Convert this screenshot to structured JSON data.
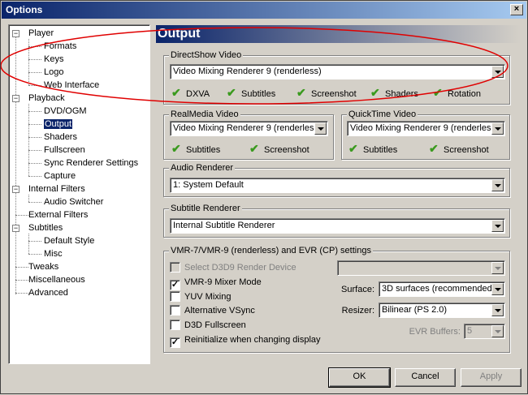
{
  "window": {
    "title": "Options",
    "close_label": "×"
  },
  "tree": {
    "items": [
      {
        "label": "Player"
      },
      {
        "label": "Formats"
      },
      {
        "label": "Keys"
      },
      {
        "label": "Logo"
      },
      {
        "label": "Web Interface"
      },
      {
        "label": "Playback"
      },
      {
        "label": "DVD/OGM"
      },
      {
        "label": "Output"
      },
      {
        "label": "Shaders"
      },
      {
        "label": "Fullscreen"
      },
      {
        "label": "Sync Renderer Settings"
      },
      {
        "label": "Capture"
      },
      {
        "label": "Internal Filters"
      },
      {
        "label": "Audio Switcher"
      },
      {
        "label": "External Filters"
      },
      {
        "label": "Subtitles"
      },
      {
        "label": "Default Style"
      },
      {
        "label": "Misc"
      },
      {
        "label": "Tweaks"
      },
      {
        "label": "Miscellaneous"
      },
      {
        "label": "Advanced"
      }
    ],
    "selected": "Output"
  },
  "page": {
    "title": "Output"
  },
  "directshow": {
    "label": "DirectShow Video",
    "value": "Video Mixing Renderer 9 (renderless)",
    "features": [
      "DXVA",
      "Subtitles",
      "Screenshot",
      "Shaders",
      "Rotation"
    ]
  },
  "realmedia": {
    "label": "RealMedia Video",
    "value": "Video Mixing Renderer 9 (renderless)",
    "features": [
      "Subtitles",
      "Screenshot"
    ]
  },
  "quicktime": {
    "label": "QuickTime Video",
    "value": "Video Mixing Renderer 9 (renderless)",
    "features": [
      "Subtitles",
      "Screenshot"
    ]
  },
  "audio": {
    "label": "Audio Renderer",
    "value": "1: System Default"
  },
  "subtitle": {
    "label": "Subtitle Renderer",
    "value": "Internal Subtitle Renderer"
  },
  "vmr": {
    "label": "VMR-7/VMR-9 (renderless) and EVR (CP) settings",
    "checks": [
      {
        "label": "Select D3D9 Render Device",
        "checked": false,
        "disabled": true
      },
      {
        "label": "VMR-9 Mixer Mode",
        "checked": true,
        "disabled": false
      },
      {
        "label": "YUV Mixing",
        "checked": false,
        "disabled": false
      },
      {
        "label": "Alternative VSync",
        "checked": false,
        "disabled": false
      },
      {
        "label": "D3D Fullscreen",
        "checked": false,
        "disabled": false
      },
      {
        "label": "Reinitialize when changing display",
        "checked": true,
        "disabled": false
      }
    ],
    "device_value": "",
    "surface_label": "Surface:",
    "surface_value": "3D surfaces (recommended)",
    "resizer_label": "Resizer:",
    "resizer_value": "Bilinear (PS 2.0)",
    "evr_label": "EVR Buffers:",
    "evr_value": "5"
  },
  "buttons": {
    "ok": "OK",
    "cancel": "Cancel",
    "apply": "Apply"
  },
  "icons": {
    "check_mark": "✔",
    "checkbox_check": "✓"
  },
  "colors": {
    "annotation_ellipse": "#e00000",
    "selection": "#0a246a",
    "check_green": "#3a9a1e"
  }
}
